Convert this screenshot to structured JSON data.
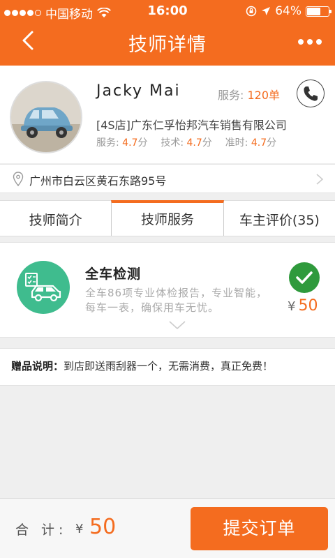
{
  "status_bar": {
    "carrier": "中国移动",
    "time": "16:00",
    "battery": "64%",
    "battery_level": 0.64
  },
  "nav": {
    "title": "技师详情",
    "back_icon": "chevron-left-icon",
    "more_icon": "more-dots-icon"
  },
  "profile": {
    "name": "Jacky Mai",
    "service_label": "服务:",
    "service_count": "120单",
    "store_tag": "[4S店]",
    "company": "广东仁孚怡邦汽车销售有限公司",
    "ratings": [
      {
        "label": "服务:",
        "score": "4.7",
        "unit": "分"
      },
      {
        "label": "技术:",
        "score": "4.7",
        "unit": "分"
      },
      {
        "label": "准时:",
        "score": "4.7",
        "unit": "分"
      }
    ]
  },
  "address": "广州市白云区黄石东路95号",
  "tabs": [
    "技师简介",
    "技师服务",
    "车主评价(35)"
  ],
  "active_tab": 1,
  "service": {
    "title": "全车检测",
    "description": "全车86项专业体检报告，专业智能，每车一表，确保用车无忧。",
    "currency": "¥",
    "price": "50",
    "selected": true
  },
  "gift": {
    "label": "赠品说明：",
    "text": "到店即送雨刮器一个，无需消费，真正免费！"
  },
  "footer": {
    "total_label": "合 计:",
    "currency": "¥",
    "total": "50",
    "submit": "提交订单"
  },
  "colors": {
    "accent": "#f46c1f",
    "service_icon_bg": "#3fbc8e",
    "check": "#2f9a3c"
  }
}
